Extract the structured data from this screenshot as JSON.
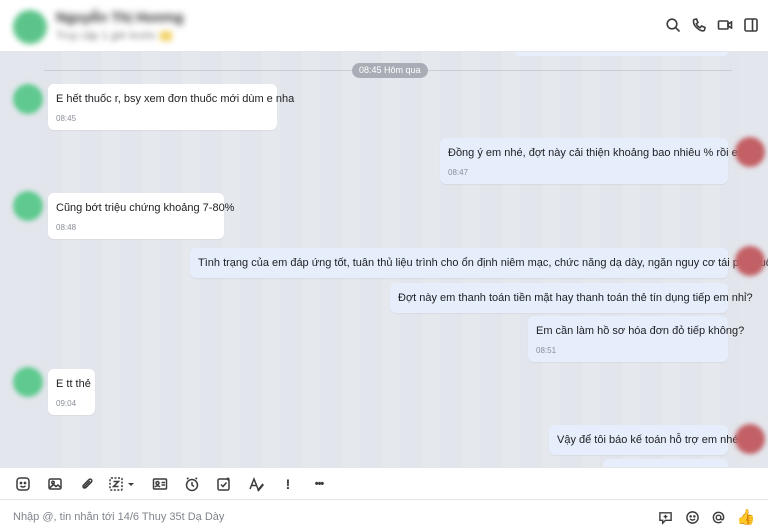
{
  "header": {
    "contact_name": "Nguyễn Thị Hương",
    "contact_sub": "Truy cập 1 giờ trước"
  },
  "chat": {
    "date_divider": "08:45 Hôm qua",
    "messages": [
      {
        "side": "in",
        "text": "E hết thuốc r, bsy xem đơn thuốc mới dùm e nha",
        "time": "08:45"
      },
      {
        "side": "out",
        "text": "Đồng ý em nhé, đợt này cải thiện khoảng bao nhiêu % rồi em?",
        "time": "08:47"
      },
      {
        "side": "in",
        "text": "Cũng bớt triệu chứng khoảng 7-80%",
        "time": "08:48"
      },
      {
        "side": "out",
        "text": "Tình trạng của em đáp ứng tốt, tuân thủ liệu trình cho ổn định niêm mạc, chức năng dạ dày, ngăn nguy cơ tái phát luôn",
        "time": ""
      },
      {
        "side": "out",
        "text": "Đợt này em thanh toán tiền mặt hay thanh toán thẻ tín dụng tiếp em nhỉ?",
        "time": ""
      },
      {
        "side": "out",
        "text": "Em cần làm hồ sơ hóa đơn đỏ tiếp không?",
        "time": "08:51"
      },
      {
        "side": "in",
        "text": "E tt thẻ",
        "time": "09:04"
      },
      {
        "side": "out",
        "text": "Vậy để tôi báo kế toán hỗ trợ em nhé",
        "time": ""
      }
    ]
  },
  "toolbar": {
    "more_label": "•••",
    "important_label": "!"
  },
  "composer": {
    "placeholder": "Nhập @, tin nhắn tới 14/6 Thuy 35t Dạ Dày",
    "thumb": "👍"
  },
  "colors": {
    "chat_bg": "#e3e6ec",
    "bubble_in": "#ffffff",
    "bubble_out": "#e6eefc",
    "time_pill": "#a9adb6"
  }
}
